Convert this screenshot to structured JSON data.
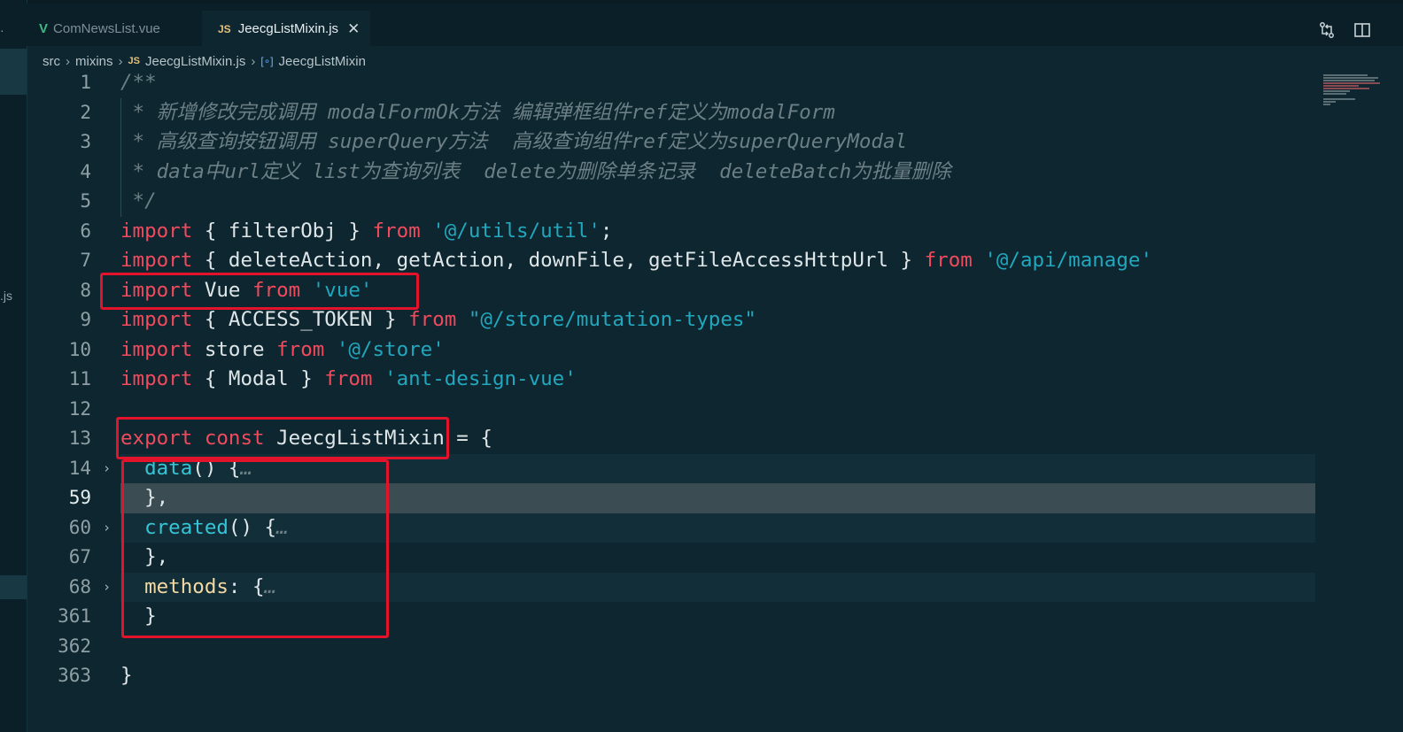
{
  "tabs": [
    {
      "label": "ComNewsList.vue",
      "icon": "vue-icon",
      "active": false
    },
    {
      "label": "JeecgListMixin.js",
      "icon": "js-icon",
      "active": true,
      "close": "✕"
    }
  ],
  "breadcrumb": {
    "parts": [
      "src",
      "mixins",
      "JeecgListMixin.js",
      "JeecgListMixin"
    ]
  },
  "sidebar": {
    "dot": "·",
    "file_suffix": ".js"
  },
  "editor": {
    "lines": [
      {
        "n": "1",
        "tokens": [
          [
            "cm",
            "/**"
          ]
        ]
      },
      {
        "n": "2",
        "tokens": [
          [
            "cm",
            " * 新增修改完成调用 modalFormOk方法 编辑弹框组件ref定义为modalForm"
          ]
        ]
      },
      {
        "n": "3",
        "tokens": [
          [
            "cm",
            " * 高级查询按钮调用 superQuery方法  高级查询组件ref定义为superQueryModal"
          ]
        ]
      },
      {
        "n": "4",
        "tokens": [
          [
            "cm",
            " * data中url定义 list为查询列表  delete为删除单条记录  deleteBatch为批量删除"
          ]
        ]
      },
      {
        "n": "5",
        "tokens": [
          [
            "cm",
            " */"
          ]
        ]
      },
      {
        "n": "6",
        "tokens": [
          [
            "kw",
            "import"
          ],
          [
            "pl",
            " { filterObj } "
          ],
          [
            "kw",
            "from"
          ],
          [
            "pl",
            " "
          ],
          [
            "str",
            "'@/utils/util'"
          ],
          [
            "pl",
            ";"
          ]
        ]
      },
      {
        "n": "7",
        "tokens": [
          [
            "kw",
            "import"
          ],
          [
            "pl",
            " { deleteAction, getAction, downFile, getFileAccessHttpUrl } "
          ],
          [
            "kw",
            "from"
          ],
          [
            "pl",
            " "
          ],
          [
            "str",
            "'@/api/manage'"
          ]
        ]
      },
      {
        "n": "8",
        "tokens": [
          [
            "kw",
            "import"
          ],
          [
            "pl",
            " Vue "
          ],
          [
            "kw",
            "from"
          ],
          [
            "pl",
            " "
          ],
          [
            "str",
            "'vue'"
          ]
        ]
      },
      {
        "n": "9",
        "tokens": [
          [
            "kw",
            "import"
          ],
          [
            "pl",
            " { ACCESS_TOKEN } "
          ],
          [
            "kw",
            "from"
          ],
          [
            "pl",
            " "
          ],
          [
            "str",
            "\"@/store/mutation-types\""
          ]
        ]
      },
      {
        "n": "10",
        "tokens": [
          [
            "kw",
            "import"
          ],
          [
            "pl",
            " store "
          ],
          [
            "kw",
            "from"
          ],
          [
            "pl",
            " "
          ],
          [
            "str",
            "'@/store'"
          ]
        ]
      },
      {
        "n": "11",
        "tokens": [
          [
            "kw",
            "import"
          ],
          [
            "pl",
            " { Modal } "
          ],
          [
            "kw",
            "from"
          ],
          [
            "pl",
            " "
          ],
          [
            "str",
            "'ant-design-vue'"
          ]
        ]
      },
      {
        "n": "12",
        "tokens": []
      },
      {
        "n": "13",
        "tokens": [
          [
            "kw",
            "export"
          ],
          [
            "pl",
            " "
          ],
          [
            "kw",
            "const"
          ],
          [
            "pl",
            " JeecgListMixin = {"
          ]
        ]
      },
      {
        "n": "14",
        "fold": true,
        "bg": "fold",
        "tokens": [
          [
            "pl",
            "  "
          ],
          [
            "fn",
            "data"
          ],
          [
            "pl",
            "() {"
          ],
          [
            "cm",
            "…"
          ]
        ]
      },
      {
        "n": "59",
        "bg": "current",
        "current": true,
        "tokens": [
          [
            "pl",
            "  },"
          ]
        ]
      },
      {
        "n": "60",
        "fold": true,
        "bg": "fold",
        "tokens": [
          [
            "pl",
            "  "
          ],
          [
            "fn",
            "created"
          ],
          [
            "pl",
            "() {"
          ],
          [
            "cm",
            "…"
          ]
        ]
      },
      {
        "n": "67",
        "tokens": [
          [
            "pl",
            "  },"
          ]
        ]
      },
      {
        "n": "68",
        "fold": true,
        "bg": "fold",
        "tokens": [
          [
            "pl",
            "  "
          ],
          [
            "prop",
            "methods"
          ],
          [
            "pl",
            ": {"
          ],
          [
            "cm",
            "…"
          ]
        ]
      },
      {
        "n": "361",
        "tokens": [
          [
            "pl",
            "  }"
          ]
        ]
      },
      {
        "n": "362",
        "tokens": []
      },
      {
        "n": "363",
        "tokens": [
          [
            "pl",
            "}"
          ]
        ]
      }
    ]
  },
  "annotations": [
    "import-vue-highlight",
    "export-const-highlight",
    "mixin-body-highlight"
  ]
}
